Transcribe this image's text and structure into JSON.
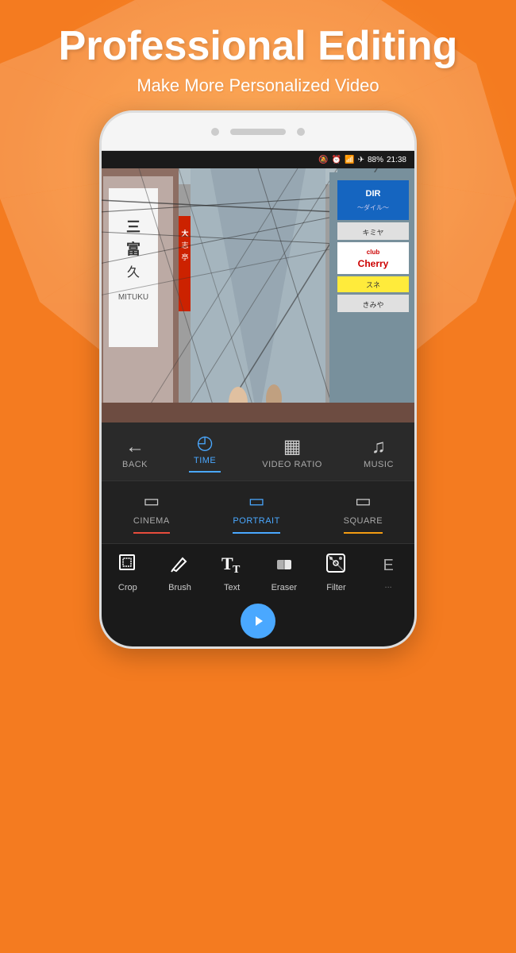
{
  "header": {
    "title": "Professional Editing",
    "subtitle": "Make More Personalized Video",
    "bg_color": "#F47B20"
  },
  "status_bar": {
    "time": "21:38",
    "battery": "88%",
    "icons": "🔕 ⏰ 📶 ✈ 🔋"
  },
  "toolbar": {
    "back_label": "BACK",
    "time_label": "TIME",
    "video_ratio_label": "VIDEO RATIO",
    "music_label": "MUSIC",
    "active": "TIME"
  },
  "ratio_options": [
    {
      "id": "cinema",
      "label": "CINEMA",
      "active": false,
      "color": "cinema"
    },
    {
      "id": "portrait",
      "label": "PORTRAIT",
      "active": true,
      "color": "portrait"
    },
    {
      "id": "square",
      "label": "SQUARE",
      "active": false,
      "color": "square"
    }
  ],
  "edit_tools": [
    {
      "id": "crop",
      "label": "Crop",
      "icon": "crop"
    },
    {
      "id": "brush",
      "label": "Brush",
      "icon": "brush"
    },
    {
      "id": "text",
      "label": "Text",
      "icon": "text"
    },
    {
      "id": "eraser",
      "label": "Eraser",
      "icon": "eraser"
    },
    {
      "id": "filter",
      "label": "Filter",
      "icon": "filter"
    },
    {
      "id": "more",
      "label": "E",
      "icon": "more"
    }
  ]
}
